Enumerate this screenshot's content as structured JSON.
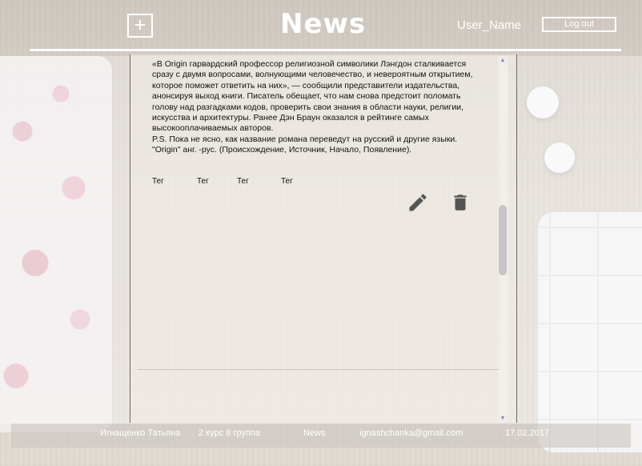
{
  "header": {
    "add_label": "+",
    "logo": "News",
    "username": "User_Name",
    "logout_label": "Log out"
  },
  "article": {
    "lines": [
      "«В Origin гарвардский профессор религиозной символики Лэнгдон сталкивается",
      "сразу с двумя вопросами, волнующими человечество, и невероятным открытием,",
      "которое поможет ответить на них», — сообщили представители издательства,",
      "анонсируя выход книги. Писатель обещает, что нам снова предстоит поломать",
      "голову над разгадками кодов, проверить свои знания в области науки, религии,",
      "искусства и архитектуры. Ранее Дэн Браун оказался в рейтинге самых",
      "высокооплачиваемых авторов.",
      "P.S. Пока не ясно, как название романа переведут на русский и другие языки.",
      "\"Origin\" анг. -рус. (Происхождение, Источник, Начало, Появление)."
    ],
    "tags": [
      "Тег",
      "Тег",
      "Тег",
      "Тег"
    ]
  },
  "icons": {
    "edit": "pencil-icon",
    "delete": "trash-icon",
    "icon_color": "#555555"
  },
  "footer": {
    "author": "Игнащенко Татьяна",
    "group": "2 курс 8 группа",
    "section": "News",
    "email": "ignashchanka@gmail.com",
    "date": "17.02.2017"
  }
}
